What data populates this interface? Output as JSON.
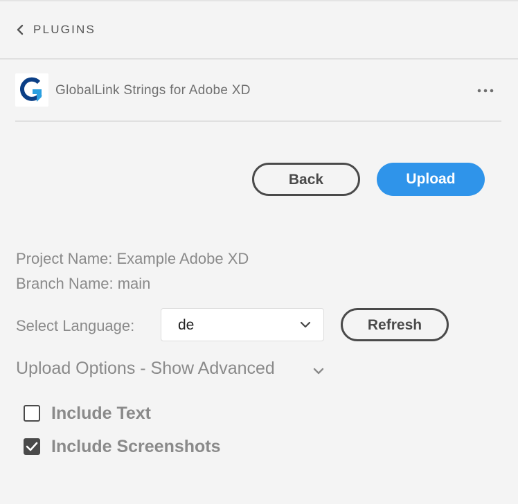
{
  "header": {
    "back_icon": "chevron-left-icon",
    "title": "PLUGINS"
  },
  "plugin": {
    "logo_icon": "globallink-g-logo",
    "name": "GlobalLink Strings for Adobe XD",
    "more_icon": "more-horizontal-icon"
  },
  "actions": {
    "back_label": "Back",
    "upload_label": "Upload"
  },
  "project": {
    "project_name": "Project Name: Example Adobe XD",
    "branch_name": "Branch Name: main"
  },
  "language": {
    "label": "Select Language:",
    "selected": "de",
    "refresh_label": "Refresh"
  },
  "upload_options": {
    "label": "Upload Options - Show Advanced",
    "options": [
      {
        "label": "Include Text",
        "checked": false
      },
      {
        "label": "Include Screenshots",
        "checked": true
      }
    ]
  },
  "colors": {
    "accent": "#2f94ea",
    "logo_blue": "#0b3f86",
    "logo_light_blue": "#2a9fe0"
  }
}
